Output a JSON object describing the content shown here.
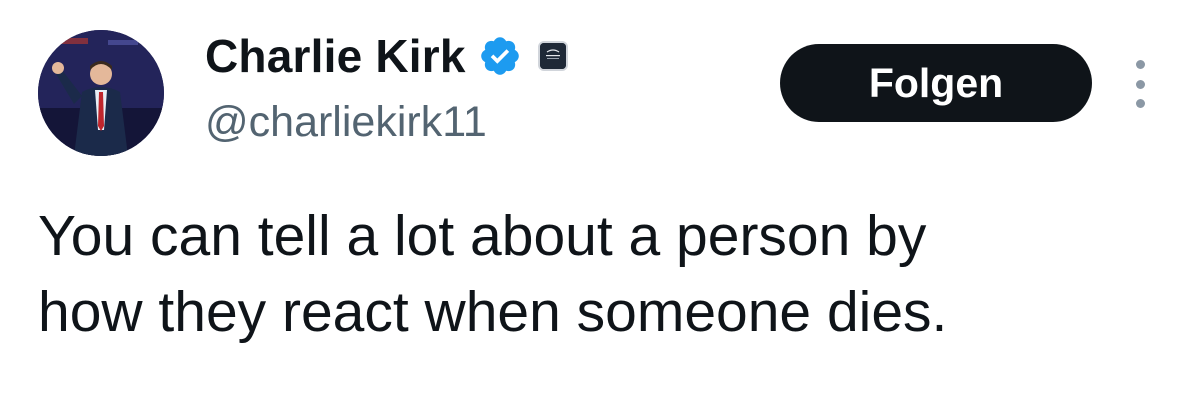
{
  "author": {
    "display_name": "Charlie Kirk",
    "handle": "@charliekirk11",
    "verified": true,
    "avatar_icon": "profile-photo-icon",
    "affiliate_icon": "organization-badge-icon"
  },
  "actions": {
    "follow_label": "Folgen",
    "more_icon": "more-options-icon"
  },
  "tweet": {
    "text_lines": [
      "You can tell a lot about a person by",
      "how they react when someone dies."
    ]
  },
  "colors": {
    "verified_blue": "#1d9bf0",
    "button_bg": "#0f1419",
    "handle_gray": "#536471"
  }
}
